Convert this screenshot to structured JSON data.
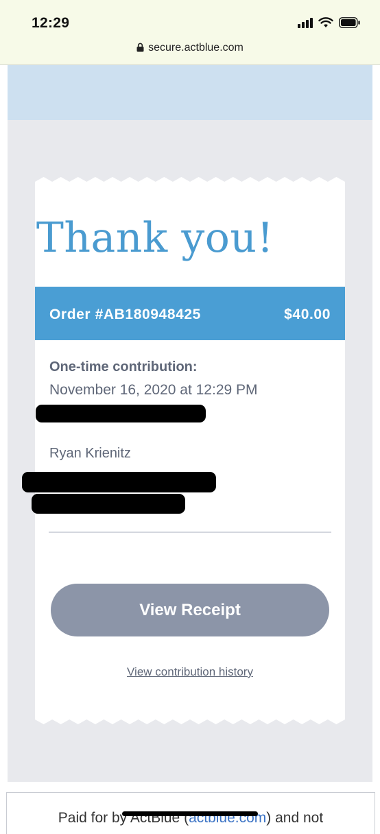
{
  "status_bar": {
    "time": "12:29",
    "url": "secure.actblue.com",
    "icons": [
      "signal-icon",
      "wifi-icon",
      "battery-icon",
      "lock-icon"
    ]
  },
  "receipt": {
    "heading": "Thank you!",
    "order_number": "Order #AB180948425",
    "amount": "$40.00",
    "contribution_label": "One-time contribution:",
    "contribution_date": "November 16, 2020 at 12:29 PM",
    "donor_name": "Ryan Krienitz",
    "view_receipt_label": "View Receipt",
    "history_link": "View contribution history"
  },
  "footer": {
    "text_before": "Paid for by ActBlue (",
    "link": "actblue.com",
    "text_after": ") and not"
  },
  "colors": {
    "accent": "#4a9ed4",
    "heading": "#4a9bd0",
    "button": "#8c95a8",
    "text": "#5f6778",
    "page_bg": "#e8e9ed",
    "banner": "#cde0f0"
  }
}
